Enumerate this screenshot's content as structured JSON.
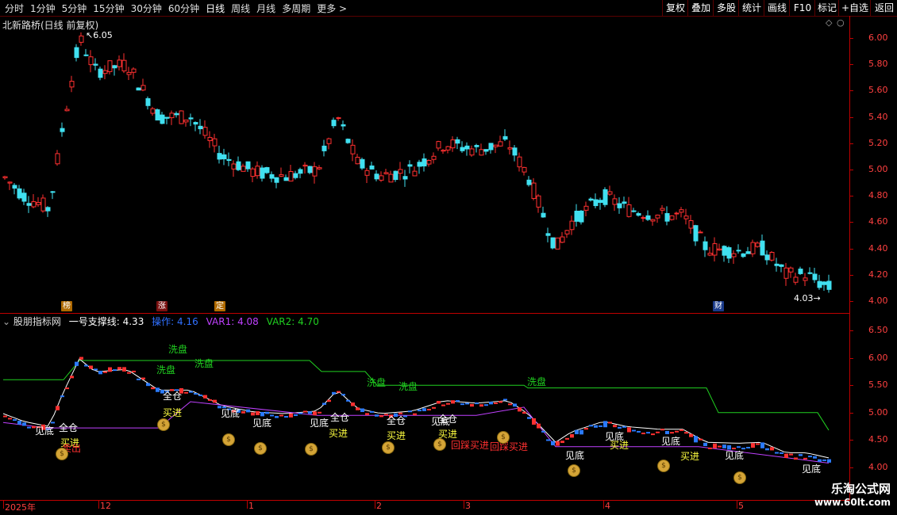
{
  "toolbar": {
    "periods": [
      "分时",
      "1分钟",
      "5分钟",
      "15分钟",
      "30分钟",
      "60分钟",
      "日线",
      "周线",
      "月线",
      "多周期",
      "更多 >"
    ],
    "active_period": "日线",
    "right_buttons": [
      "复权",
      "叠加",
      "多股",
      "统计",
      "画线",
      "F10",
      "标记",
      "+自选",
      "返回"
    ]
  },
  "main_pane": {
    "title": "北新路桥(日线 前复权)",
    "max_price_label": "6.05",
    "min_price_label": "4.03",
    "y_ticks": [
      "6.00",
      "5.80",
      "5.60",
      "5.40",
      "5.20",
      "5.00",
      "4.80",
      "4.60",
      "4.40",
      "4.20",
      "4.00"
    ],
    "badges": [
      {
        "text": "榜",
        "bg": "#b06a00"
      },
      {
        "text": "涨",
        "bg": "#7a1010"
      },
      {
        "text": "定",
        "bg": "#b06a00"
      },
      {
        "text": "财",
        "bg": "#1a3a8a"
      }
    ]
  },
  "indicator_pane": {
    "name": "股朋指标网",
    "line1_label": "一号支撑线:",
    "line1_value": "4.33",
    "op_label": "操作:",
    "op_value": "4.16",
    "var1_label": "VAR1:",
    "var1_value": "4.08",
    "var2_label": "VAR2:",
    "var2_value": "4.70",
    "y_ticks": [
      "6.50",
      "6.00",
      "5.50",
      "5.00",
      "4.50",
      "4.00"
    ],
    "annotations": {
      "wash": "洗盘",
      "bottom": "见底",
      "buy": "买进",
      "full": "全仓",
      "sell": "卖出",
      "pullback_buy": "回踩买进"
    }
  },
  "date_axis": [
    "2025年",
    "12",
    "1",
    "2",
    "3",
    "4",
    "5"
  ],
  "watermark": {
    "line1": "乐淘公式网",
    "line2": "www.60lt.com"
  },
  "colors": {
    "up": "#ff3030",
    "down": "#40e0f0",
    "axis": "#ff4040",
    "wash": "#20d020",
    "bottom": "#ffffff",
    "buy": "#ffff40",
    "purple": "#c040ff"
  }
}
